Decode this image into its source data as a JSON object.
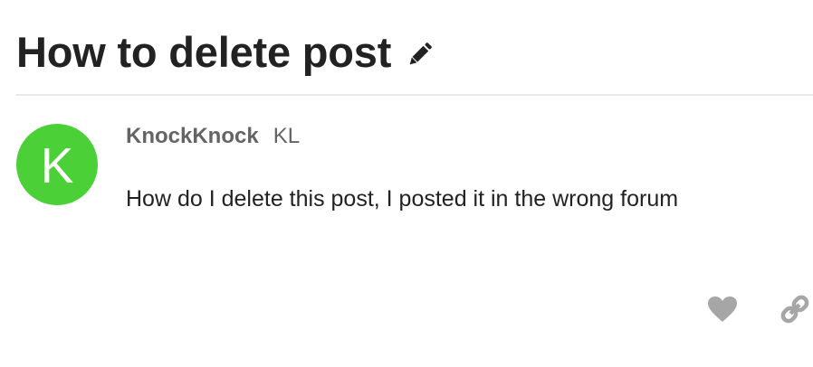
{
  "topic": {
    "title": "How to delete post",
    "edit_icon": "pencil-icon"
  },
  "post": {
    "avatar": {
      "letter": "K",
      "color": "#4cd038"
    },
    "username": "KnockKnock",
    "full_name": "KL",
    "body": "How do I delete this post, I posted it in the wrong forum",
    "actions": {
      "like_icon": "heart-icon",
      "link_icon": "link-icon",
      "icon_color": "#a6a6a6"
    }
  }
}
